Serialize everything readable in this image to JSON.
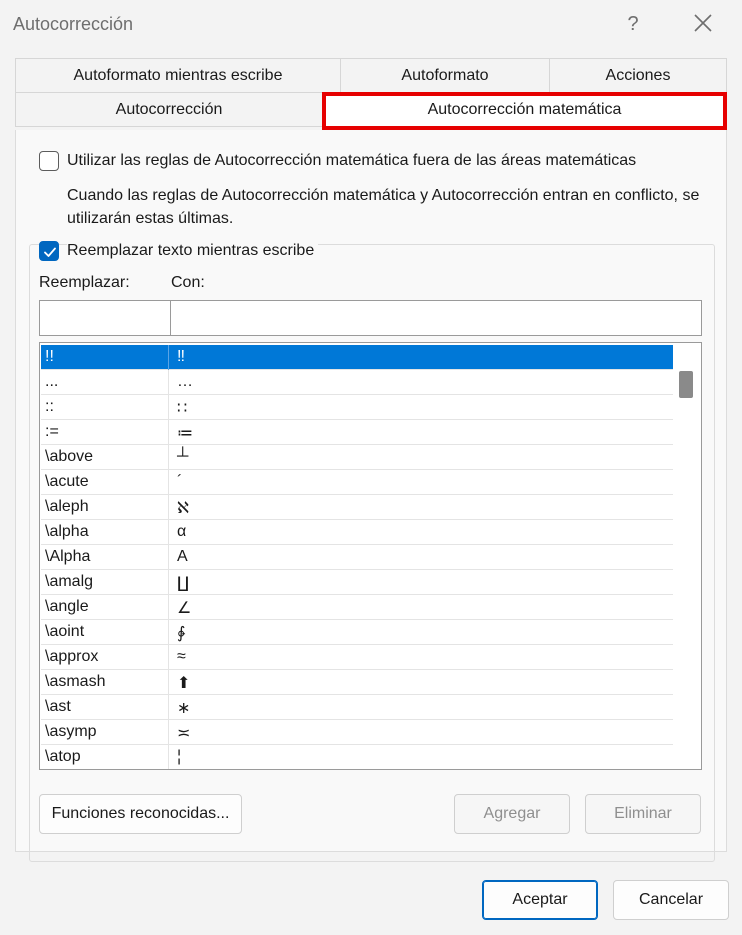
{
  "window": {
    "title": "Autocorrección",
    "help_glyph": "?"
  },
  "tabs": {
    "row1": [
      "Autoformato mientras escribe",
      "Autoformato",
      "Acciones"
    ],
    "row2": [
      "Autocorrección",
      "Autocorrección matemática"
    ],
    "active": "Autocorrección matemática",
    "highlight_color": "#e60000"
  },
  "options": {
    "use_outside_math": {
      "checked": false,
      "label": "Utilizar las reglas de Autocorrección matemática fuera de las áreas matemáticas"
    },
    "note": "Cuando las reglas de Autocorrección matemática y Autocorrección entran en conflicto, se utilizarán estas últimas.",
    "replace_as_you_type": {
      "checked": true,
      "label": "Reemplazar texto mientras escribe"
    }
  },
  "fields": {
    "replace_label": "Reemplazar:",
    "with_label": "Con:",
    "replace_value": "",
    "with_value": ""
  },
  "list": {
    "selected_index": 0,
    "rows": [
      {
        "replace": "!!",
        "with": "‼"
      },
      {
        "replace": "...",
        "with": "…"
      },
      {
        "replace": "::",
        "with": "∷"
      },
      {
        "replace": ":=",
        "with": "≔"
      },
      {
        "replace": "\\above",
        "with": "┴"
      },
      {
        "replace": "\\acute",
        "with": "´"
      },
      {
        "replace": "\\aleph",
        "with": "ℵ"
      },
      {
        "replace": "\\alpha",
        "with": "α"
      },
      {
        "replace": "\\Alpha",
        "with": "Α"
      },
      {
        "replace": "\\amalg",
        "with": "∐"
      },
      {
        "replace": "\\angle",
        "with": "∠"
      },
      {
        "replace": "\\aoint",
        "with": "∳"
      },
      {
        "replace": "\\approx",
        "with": "≈"
      },
      {
        "replace": "\\asmash",
        "with": "⬆"
      },
      {
        "replace": "\\ast",
        "with": "∗"
      },
      {
        "replace": "\\asymp",
        "with": "≍"
      },
      {
        "replace": "\\atop",
        "with": "¦"
      }
    ]
  },
  "buttons": {
    "recognized_functions": "Funciones reconocidas...",
    "add": "Agregar",
    "delete": "Eliminar",
    "ok": "Aceptar",
    "cancel": "Cancelar"
  },
  "colors": {
    "accent": "#0067c0",
    "selection": "#0078d7"
  }
}
